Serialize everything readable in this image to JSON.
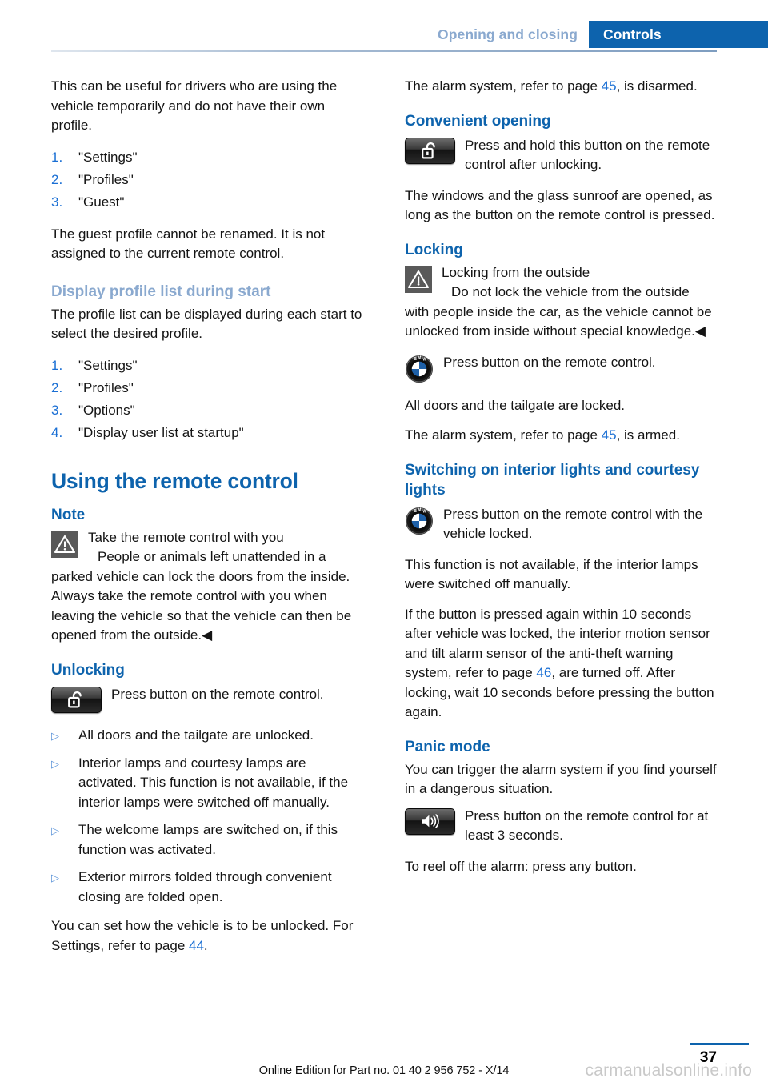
{
  "header": {
    "section": "Opening and closing",
    "chapter": "Controls"
  },
  "left_column": {
    "intro": "This can be useful for drivers who are using the vehicle temporarily and do not have their own profile.",
    "steps_1": [
      {
        "num": "1.",
        "text": "\"Settings\""
      },
      {
        "num": "2.",
        "text": "\"Profiles\""
      },
      {
        "num": "3.",
        "text": "\"Guest\""
      }
    ],
    "guest_note": "The guest profile cannot be renamed. It is not assigned to the current remote control.",
    "subhead_display_profile": "Display profile list during start",
    "display_profile_body": "The profile list can be displayed during each start to select the desired profile.",
    "steps_2": [
      {
        "num": "1.",
        "text": "\"Settings\""
      },
      {
        "num": "2.",
        "text": "\"Profiles\""
      },
      {
        "num": "3.",
        "text": "\"Options\""
      },
      {
        "num": "4.",
        "text": "\"Display user list at startup\""
      }
    ],
    "chapter_title": "Using the remote control",
    "note_heading": "Note",
    "note_warning_title": "Take the remote control with you",
    "note_warning_body": "People or animals left unattended in a parked vehicle can lock the doors from the inside. Always take the remote control with you when leaving the vehicle so that the vehicle can then be opened from the outside.◀",
    "unlocking_heading": "Unlocking",
    "unlocking_icon_text": "Press button on the remote control.",
    "unlocking_bullets": [
      "All doors and the tailgate are unlocked.",
      "Interior lamps and courtesy lamps are activated. This function is not available, if the interior lamps were switched off manually.",
      "The welcome lamps are switched on, if this function was activated.",
      "Exterior mirrors folded through convenient closing are folded open."
    ],
    "settings_text_before": "You can set how the vehicle is to be unlocked. For Settings, refer to page ",
    "settings_pageref": "44",
    "settings_text_after": "."
  },
  "right_column": {
    "alarm_disarmed_before": "The alarm system, refer to page ",
    "alarm_disarmed_ref": "45",
    "alarm_disarmed_after": ", is disarmed.",
    "convenient_opening_heading": "Convenient opening",
    "convenient_opening_icon_text": "Press and hold this button on the remote control after unlocking.",
    "convenient_opening_body": "The windows and the glass sunroof are opened, as long as the button on the remote control is pressed.",
    "locking_heading": "Locking",
    "locking_warning_title": "Locking from the outside",
    "locking_warning_body": "Do not lock the vehicle from the outside with people inside the car, as the vehicle cannot be unlocked from inside without special knowledge.◀",
    "locking_icon_text": "Press button on the remote control.",
    "locked_body": "All doors and the tailgate are locked.",
    "alarm_armed_before": "The alarm system, refer to page ",
    "alarm_armed_ref": "45",
    "alarm_armed_after": ", is armed.",
    "interior_lights_heading": "Switching on interior lights and courtesy lights",
    "interior_lights_icon_text": "Press button on the remote control with the vehicle locked.",
    "interior_lights_body": "This function is not available, if the interior lamps were switched off manually.",
    "ten_seconds_before": "If the button is pressed again within 10 seconds after vehicle was locked, the interior motion sensor and tilt alarm sensor of the anti-theft warning system, refer to page ",
    "ten_seconds_ref": "46",
    "ten_seconds_after": ", are turned off. After locking, wait 10 seconds before pressing the button again.",
    "panic_mode_heading": "Panic mode",
    "panic_mode_body": "You can trigger the alarm system if you find yourself in a dangerous situation.",
    "panic_icon_text": "Press button on the remote control for at least 3 seconds.",
    "reel_off_body": "To reel off the alarm: press any button."
  },
  "icons": {
    "warning": "warning-triangle-icon",
    "unlock_button": "unlock-padlock-button-icon",
    "bmw_button": "bmw-roundel-button-icon",
    "panic_button": "speaker-alarm-button-icon",
    "bullet": "▷"
  },
  "footer": {
    "page_number": "37",
    "note": "Online Edition for Part no. 01 40 2 956 752 - X/14",
    "watermark": "carmanualsonline.info"
  },
  "colors": {
    "brand_blue": "#0d63ad",
    "light_blue": "#8aa9cf",
    "link_blue": "#1a6fd4",
    "bullet_blue": "#5a93d8",
    "icon_gray": "#595959"
  }
}
